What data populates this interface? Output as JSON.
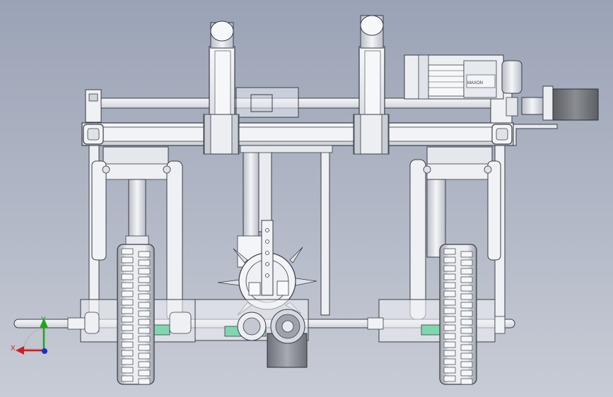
{
  "viewport": {
    "background_top": "#9aa3b6",
    "background_bottom": "#c8ccd6"
  },
  "triad": {
    "y_label": "Y",
    "x_label": "X",
    "y_color": "#1fa51f",
    "x_color": "#d41c1c",
    "z_color": "#1a2fd0"
  },
  "model": {
    "motor_label": "MAXON",
    "part_colors": {
      "frame": "#eef0f4",
      "edge": "#3a3d45",
      "bearing": "#7fd7b0",
      "stepper": "#6f7276",
      "wheel_tread": "#e4e6ea"
    }
  }
}
